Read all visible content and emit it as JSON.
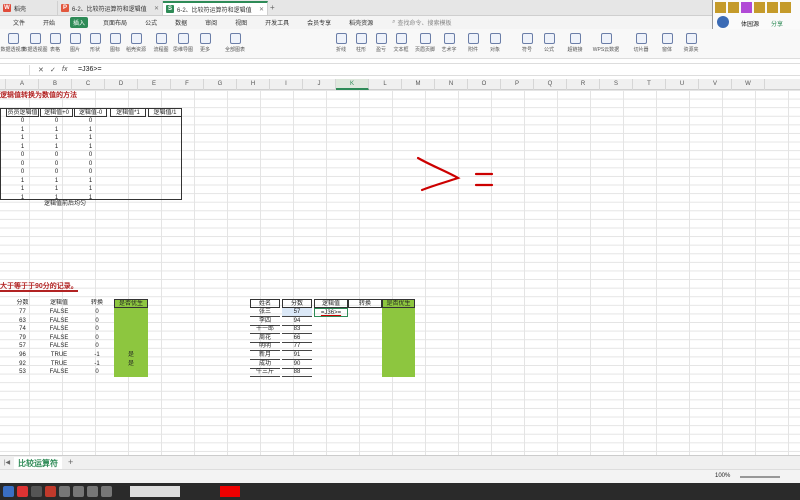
{
  "tabs": [
    {
      "label": "稻壳",
      "active": false,
      "icon": "daoke-logo"
    },
    {
      "label": "6-2、比较符运算符和逻辑值",
      "active": false,
      "icon": "pdf-icon"
    },
    {
      "label": "6-2、比较符运算符和逻辑值",
      "active": true,
      "icon": "sheet-icon"
    }
  ],
  "menus": [
    "文件",
    "开始",
    "插入",
    "页面布局",
    "公式",
    "数据",
    "审阅",
    "视图",
    "开发工具",
    "会员专享",
    "稻壳资源"
  ],
  "active_menu": "插入",
  "search_placeholder": "查找命令、搜索模板",
  "right_panel": {
    "user": "体园源",
    "share": "分享"
  },
  "ribbon": [
    "数据透视表",
    "数据透视图",
    "表格",
    "图片",
    "形状",
    "图标",
    "稻壳资源",
    "流程图",
    "思维导图",
    "更多",
    "全部图表",
    "折线",
    "柱形",
    "盈亏",
    "文本框",
    "页眉页脚",
    "艺术字",
    "附件",
    "对象",
    "符号",
    "公式",
    "超链接",
    "WPS云数据",
    "切片器",
    "窗体",
    "资源夹"
  ],
  "formula": {
    "fx": "fx",
    "content": "=J36>="
  },
  "columns": [
    "A",
    "B",
    "C",
    "D",
    "E",
    "F",
    "G",
    "H",
    "I",
    "J",
    "K",
    "L",
    "M",
    "N",
    "O",
    "P",
    "Q",
    "R",
    "S",
    "T",
    "U",
    "V",
    "W"
  ],
  "selected_column": "K",
  "section1": {
    "title": "逻辑值转换为数值的方法",
    "headers": [
      "员员逻辑值",
      "逻辑值+0",
      "逻辑值-0",
      "逻辑值*1",
      "逻辑值/1"
    ],
    "rows": [
      [
        "0",
        "0",
        "0"
      ],
      [
        "1",
        "1",
        "1"
      ],
      [
        "1",
        "1",
        "1"
      ],
      [
        "1",
        "1",
        "1"
      ],
      [
        "0",
        "0",
        "0"
      ],
      [
        "0",
        "0",
        "0"
      ],
      [
        "0",
        "0",
        "0"
      ],
      [
        "1",
        "1",
        "1"
      ],
      [
        "1",
        "1",
        "1"
      ],
      [
        "1",
        "1",
        "1"
      ]
    ],
    "note": "逻辑值前后均匀"
  },
  "section2": {
    "title": "大于等于于90分的记录。",
    "headers": [
      "分数",
      "逻辑值",
      "转换",
      "是否优生"
    ],
    "rows": [
      {
        "score": "77",
        "logic": "FALSE",
        "conv": "0",
        "excellent": ""
      },
      {
        "score": "63",
        "logic": "FALSE",
        "conv": "0",
        "excellent": ""
      },
      {
        "score": "74",
        "logic": "FALSE",
        "conv": "0",
        "excellent": ""
      },
      {
        "score": "79",
        "logic": "FALSE",
        "conv": "0",
        "excellent": ""
      },
      {
        "score": "57",
        "logic": "FALSE",
        "conv": "0",
        "excellent": ""
      },
      {
        "score": "96",
        "logic": "TRUE",
        "conv": "-1",
        "excellent": "是"
      },
      {
        "score": "92",
        "logic": "TRUE",
        "conv": "-1",
        "excellent": "是"
      },
      {
        "score": "53",
        "logic": "FALSE",
        "conv": "0",
        "excellent": ""
      }
    ]
  },
  "section3": {
    "headers": [
      "姓名",
      "分数",
      "逻辑值",
      "转换",
      "是否优生"
    ],
    "rows": [
      {
        "name": "张三",
        "score": "57",
        "logic": "=J36>="
      },
      {
        "name": "李四",
        "score": "94",
        "logic": ""
      },
      {
        "name": "十一郎",
        "score": "83",
        "logic": ""
      },
      {
        "name": "周花",
        "score": "66",
        "logic": ""
      },
      {
        "name": "明明",
        "score": "77",
        "logic": ""
      },
      {
        "name": "新月",
        "score": "91",
        "logic": ""
      },
      {
        "name": "成功",
        "score": "90",
        "logic": ""
      },
      {
        "name": "牛三斤",
        "score": "88",
        "logic": ""
      }
    ]
  },
  "annotation_symbol": ">=",
  "sheet_tab": "比较运算符",
  "zoom": "100%",
  "colors": {
    "accent": "#2e8b57",
    "green_fill": "#8dc63f",
    "red_ink": "#cc0000"
  }
}
